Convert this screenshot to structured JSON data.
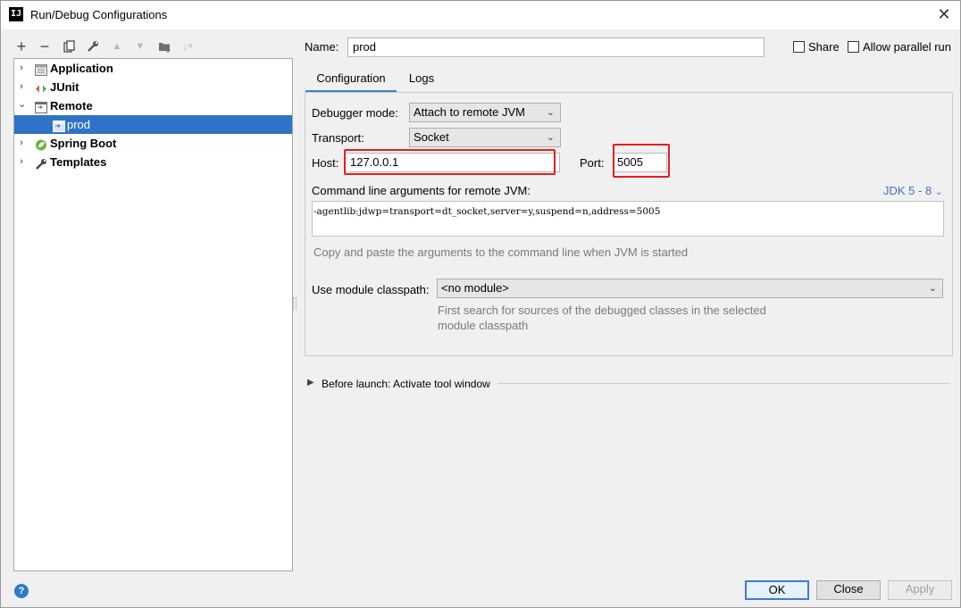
{
  "window": {
    "title": "Run/Debug Configurations",
    "app_icon_text": "IJ"
  },
  "toolbar": {
    "icons": [
      "add-icon",
      "remove-icon",
      "copy-icon",
      "wrench-icon",
      "move-up-icon",
      "move-down-icon",
      "new-folder-icon",
      "sort-icon"
    ]
  },
  "tree": {
    "items": [
      {
        "label": "Application",
        "icon": "application-icon",
        "expanded": false
      },
      {
        "label": "JUnit",
        "icon": "junit-icon",
        "expanded": false
      },
      {
        "label": "Remote",
        "icon": "remote-icon",
        "expanded": true
      },
      {
        "label": "prod",
        "icon": "remote-config-icon",
        "selected": true
      },
      {
        "label": "Spring Boot",
        "icon": "spring-boot-icon",
        "expanded": false
      },
      {
        "label": "Templates",
        "icon": "wrench-icon",
        "expanded": false
      }
    ]
  },
  "form": {
    "name_label": "Name:",
    "name_value": "prod",
    "share_label": "Share",
    "share_checked": false,
    "parallel_label": "Allow parallel run",
    "parallel_checked": false
  },
  "tabs": [
    {
      "label": "Configuration",
      "active": true
    },
    {
      "label": "Logs",
      "active": false
    }
  ],
  "config": {
    "debugger_mode_label": "Debugger mode:",
    "debugger_mode_value": "Attach to remote JVM",
    "transport_label": "Transport:",
    "transport_value": "Socket",
    "host_label": "Host:",
    "host_value": "127.0.0.1",
    "port_label": "Port:",
    "port_value": "5005",
    "cmd_label": "Command line arguments for remote JVM:",
    "jdk_link": "JDK 5 - 8",
    "cmd_value": "-agentlib:jdwp=transport=dt_socket,server=y,suspend=n,address=5005",
    "cmd_hint": "Copy and paste the arguments to the command line when JVM is started",
    "module_label": "Use module classpath:",
    "module_value": "<no module>",
    "module_hint_line1": "First search for sources of the debugged classes in the selected",
    "module_hint_line2": "module classpath"
  },
  "before_launch": "Before launch: Activate tool window",
  "buttons": {
    "ok": "OK",
    "close": "Close",
    "apply": "Apply"
  },
  "colors": {
    "selection": "#2f73c6",
    "highlight_box": "#e0201f",
    "link": "#3b73c3",
    "tab_underline": "#4083c9"
  }
}
